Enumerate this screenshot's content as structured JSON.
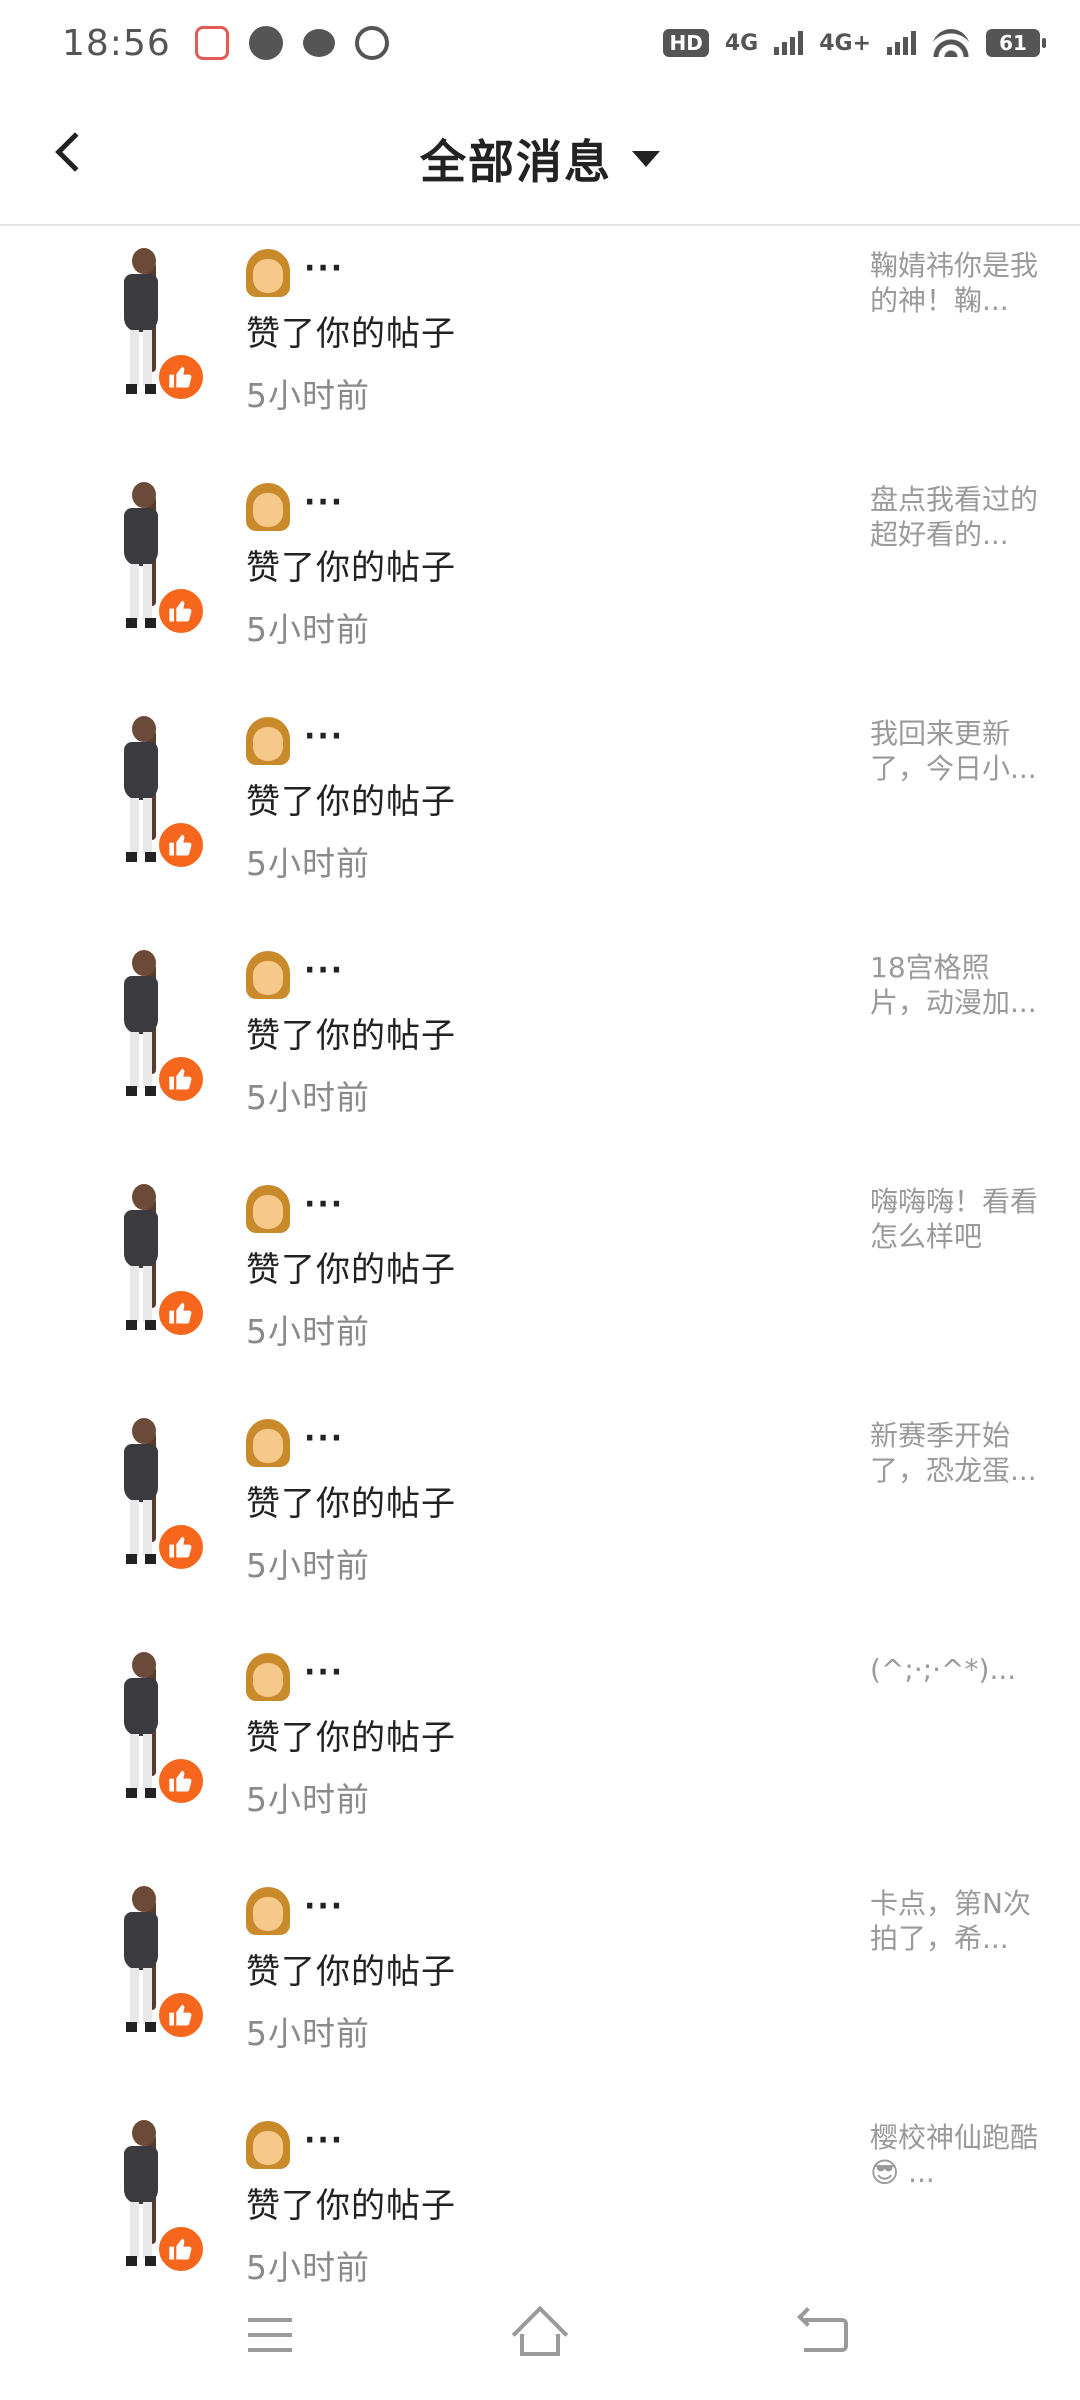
{
  "status_bar": {
    "time": "18:56",
    "hd_label": "HD",
    "network_1": "4G",
    "network_2": "4G+",
    "battery": "61"
  },
  "header": {
    "title": "全部消息"
  },
  "messages": [
    {
      "action": "赞了你的帖子",
      "time": "5小时前",
      "preview": "鞠婧祎你是我的神！鞠..."
    },
    {
      "action": "赞了你的帖子",
      "time": "5小时前",
      "preview": "盘点我看过的超好看的..."
    },
    {
      "action": "赞了你的帖子",
      "time": "5小时前",
      "preview": "我回来更新了，今日小..."
    },
    {
      "action": "赞了你的帖子",
      "time": "5小时前",
      "preview": "18宫格照片，动漫加..."
    },
    {
      "action": "赞了你的帖子",
      "time": "5小时前",
      "preview": "嗨嗨嗨！看看怎么样吧"
    },
    {
      "action": "赞了你的帖子",
      "time": "5小时前",
      "preview": "新赛季开始了，恐龙蛋..."
    },
    {
      "action": "赞了你的帖子",
      "time": "5小时前",
      "preview": "(^;·;·^*)..."
    },
    {
      "action": "赞了你的帖子",
      "time": "5小时前",
      "preview": "卡点，第N次拍了，希..."
    },
    {
      "action": "赞了你的帖子",
      "time": "5小时前",
      "preview": "樱校神仙跑酷😎 ..."
    }
  ],
  "name_placeholder": "···",
  "icons": {
    "like": "thumbs-up-icon",
    "back": "chevron-left-icon",
    "dropdown": "caret-down-icon"
  },
  "colors": {
    "like_badge": "#f6661c",
    "secondary_text": "#8a8a8a"
  }
}
